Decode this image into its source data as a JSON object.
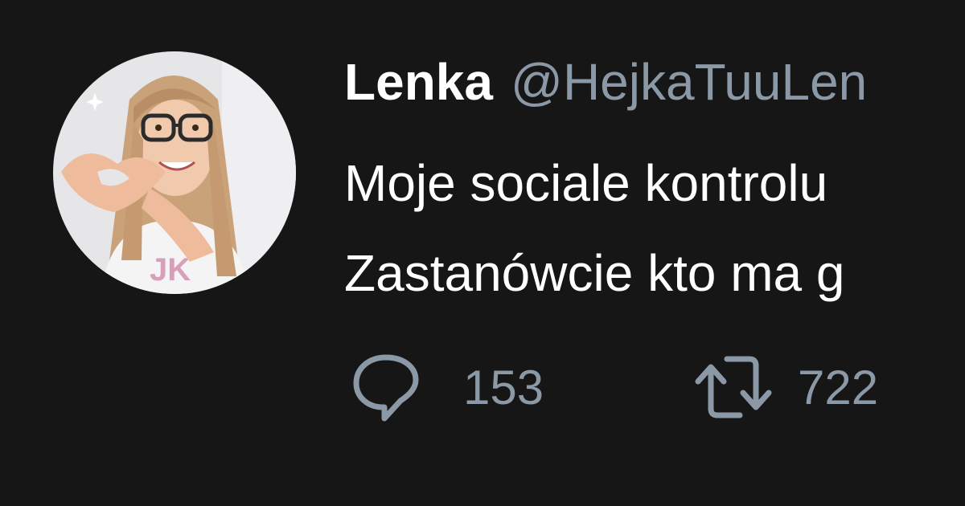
{
  "tweet": {
    "author": {
      "display_name": "Lenka",
      "handle": "@HejkaTuuLen"
    },
    "text_lines": [
      "Moje sociale kontrolu",
      "Zastanówcie kto ma g"
    ],
    "actions": {
      "reply": {
        "icon": "reply-icon",
        "count": "153"
      },
      "retweet": {
        "icon": "retweet-icon",
        "count": "722"
      }
    }
  },
  "colors": {
    "background": "#161616",
    "primary_text": "#ffffff",
    "secondary_text": "#8b98a5"
  }
}
